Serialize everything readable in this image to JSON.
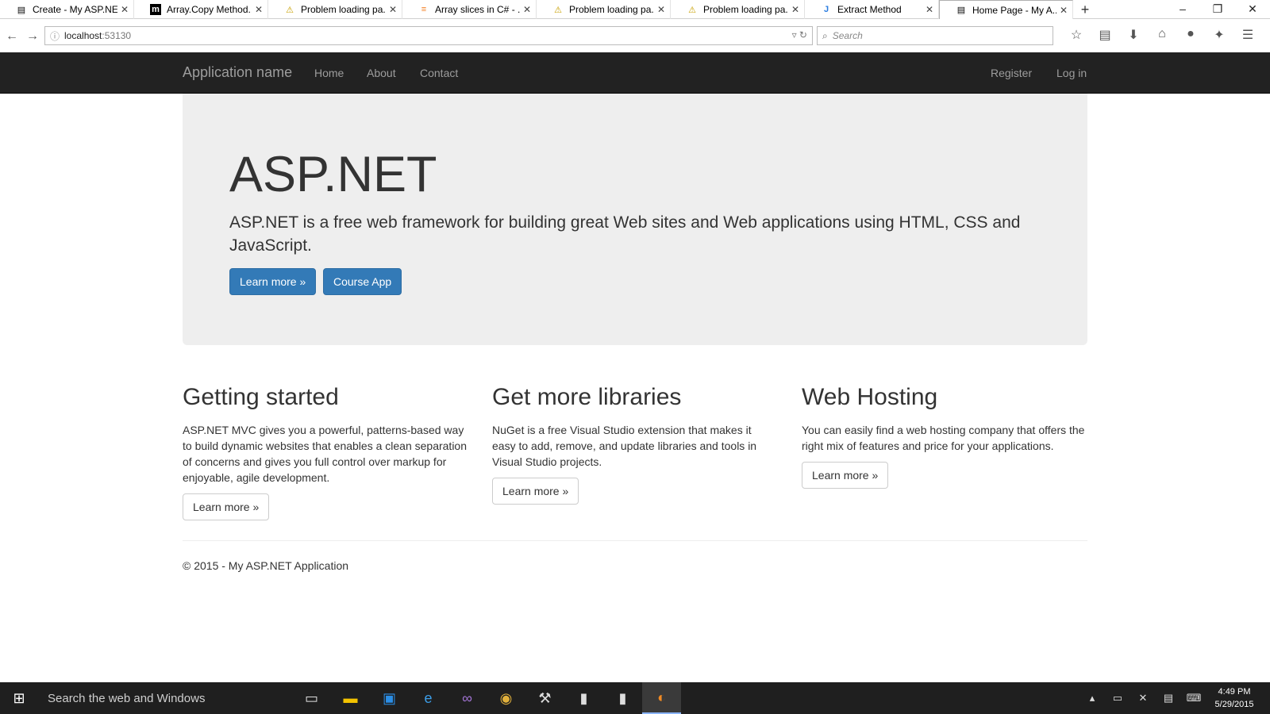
{
  "browser": {
    "tabs": [
      {
        "title": "Create - My ASP.NE...",
        "icon": "page-icon"
      },
      {
        "title": "Array.Copy Method...",
        "icon": "msdn-icon"
      },
      {
        "title": "Problem loading pa...",
        "icon": "warning-icon"
      },
      {
        "title": "Array slices in C# - ...",
        "icon": "stackoverflow-icon"
      },
      {
        "title": "Problem loading pa...",
        "icon": "warning-icon"
      },
      {
        "title": "Problem loading pa...",
        "icon": "warning-icon"
      },
      {
        "title": "Extract Method",
        "icon": "jetbrains-icon"
      },
      {
        "title": "Home Page - My A...",
        "icon": "page-icon"
      }
    ],
    "url_host": "localhost",
    "url_port": ":53130",
    "search_placeholder": "Search"
  },
  "site": {
    "brand": "Application name",
    "nav": [
      "Home",
      "About",
      "Contact"
    ],
    "nav_right": [
      "Register",
      "Log in"
    ]
  },
  "jumbotron": {
    "title": "ASP.NET",
    "lead": "ASP.NET is a free web framework for building great Web sites and Web applications using HTML, CSS and JavaScript.",
    "btn_learn": "Learn more »",
    "btn_course": "Course App"
  },
  "columns": [
    {
      "title": "Getting started",
      "text": "ASP.NET MVC gives you a powerful, patterns-based way to build dynamic websites that enables a clean separation of concerns and gives you full control over markup for enjoyable, agile development.",
      "button": "Learn more »"
    },
    {
      "title": "Get more libraries",
      "text": "NuGet is a free Visual Studio extension that makes it easy to add, remove, and update libraries and tools in Visual Studio projects.",
      "button": "Learn more »"
    },
    {
      "title": "Web Hosting",
      "text": "You can easily find a web hosting company that offers the right mix of features and price for your applications.",
      "button": "Learn more »"
    }
  ],
  "footer": "© 2015 - My ASP.NET Application",
  "taskbar": {
    "search": "Search the web and Windows",
    "time": "4:49 PM",
    "date": "5/29/2015"
  },
  "colors": {
    "navbar": "#222222",
    "primary": "#337ab7",
    "jumbotron": "#eeeeee"
  }
}
